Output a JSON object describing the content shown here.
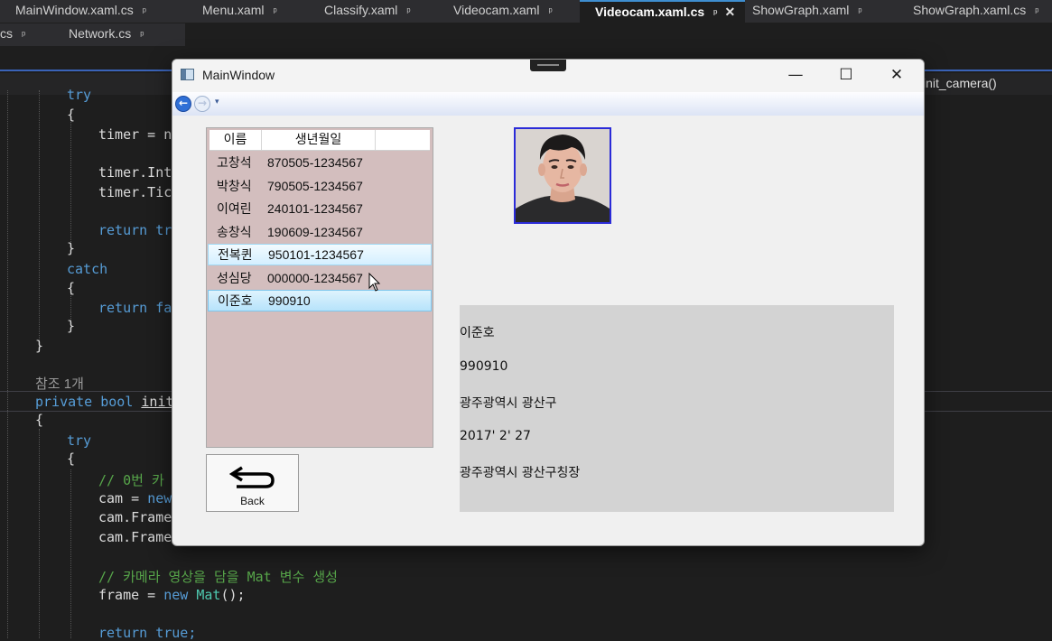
{
  "ide": {
    "tabs_row1": [
      {
        "label": "MainWindow.xaml.cs",
        "active": false
      },
      {
        "label": "Menu.xaml",
        "active": false
      },
      {
        "label": "Classify.xaml",
        "active": false
      },
      {
        "label": "Videocam.xaml",
        "active": false
      },
      {
        "label": "Videocam.xaml.cs",
        "active": true
      },
      {
        "label": "ShowGraph.xaml",
        "active": false
      },
      {
        "label": "ShowGraph.xaml.cs",
        "active": false
      }
    ],
    "tabs_row2": [
      {
        "label": "cs"
      },
      {
        "label": "Network.cs"
      }
    ],
    "pin_glyph": "ᵖ",
    "close_glyph": "✕",
    "member_dropdown": "init_camera()",
    "code": {
      "try1": "try",
      "brace_open1": "{",
      "timer_new": "timer = ne",
      "timer_interval": "timer.Inte",
      "timer_tick": "timer.Tic",
      "return_true1": "return tru",
      "brace_close1": "}",
      "catch": "catch",
      "brace_open2": "{",
      "return_false": "return fa",
      "brace_close2": "}",
      "brace_close3": "}",
      "ref_count": "참조 1개",
      "method_sig_kw": "private bool",
      "method_sig_name": "init_",
      "brace_open3": "{",
      "try2": "try",
      "brace_open4": "{",
      "comment_cam": "// 0번 카",
      "cam_new_pre": "cam = ",
      "cam_new_kw": "new",
      "cam_frame1": "cam.Frame",
      "cam_frame2": "cam.Frame",
      "comment_frame": "// 카메라 영상을 담을 Mat 변수 생성",
      "frame_pre": "frame = ",
      "frame_kw": "new",
      "frame_type": "Mat",
      "frame_post": "();",
      "return_true2_kw": "return",
      "return_true2_val": "true;"
    }
  },
  "window": {
    "title": "MainWindow",
    "minimize": "—",
    "maximize": "☐",
    "close": "✕",
    "nav_back": "←",
    "nav_forward": "→",
    "nav_dropdown": "▾",
    "list": {
      "columns": [
        "이름",
        "생년월일",
        ""
      ],
      "rows": [
        {
          "name": "고창석",
          "ssn": "870505-1234567"
        },
        {
          "name": "박창식",
          "ssn": "790505-1234567"
        },
        {
          "name": "이여린",
          "ssn": "240101-1234567"
        },
        {
          "name": "송창식",
          "ssn": "190609-1234567"
        },
        {
          "name": "전복퀸",
          "ssn": "950101-1234567"
        },
        {
          "name": "성심당",
          "ssn": "000000-1234567"
        },
        {
          "name": "이준호",
          "ssn": "990910"
        }
      ],
      "hovered_index": 4,
      "selected_index": 6
    },
    "back_button": {
      "label": "Back"
    },
    "details": {
      "name": "이준호",
      "birth": "990910",
      "address": "광주광역시 광산구",
      "date": "2017' 2' 27",
      "office": "광주광역시 광산구칭장"
    }
  }
}
